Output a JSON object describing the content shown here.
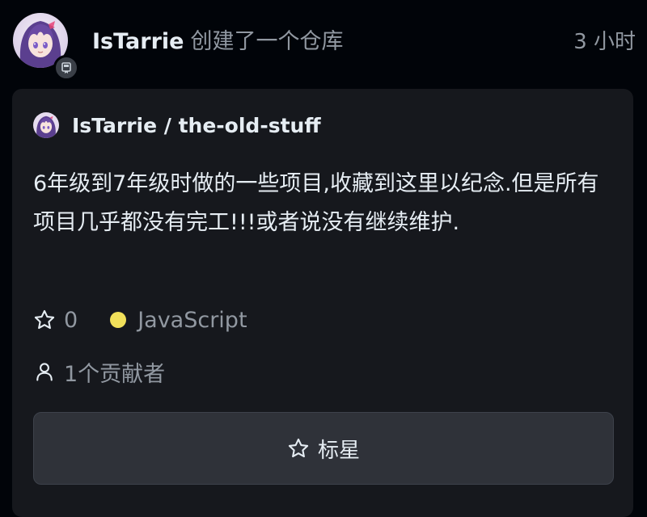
{
  "feed": {
    "user": "IsTarrie",
    "action": "创建了一个仓库",
    "time": "3 小时"
  },
  "repo": {
    "full_name": "IsTarrie / the-old-stuff",
    "description": "6年级到7年级时做的一些项目,收藏到这里以纪念.但是所有项目几乎都没有完工!!!或者说没有继续维护.",
    "stars": "0",
    "language": "JavaScript",
    "language_color": "#f1e05a",
    "contributors": "1个贡献者"
  },
  "buttons": {
    "star_label": "标星"
  },
  "icons": {
    "repo_badge": "repo-icon",
    "star": "star-icon",
    "person": "person-icon"
  }
}
